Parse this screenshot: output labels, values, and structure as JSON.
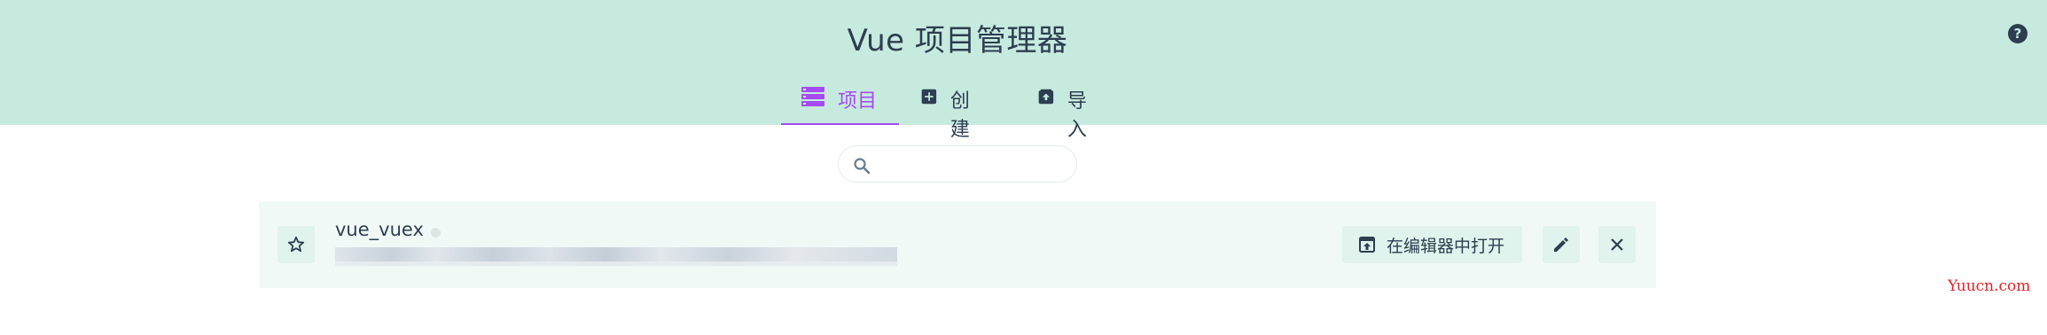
{
  "header": {
    "title": "Vue 项目管理器",
    "help_icon": "?",
    "background_color": "#c7eadf"
  },
  "tabs": [
    {
      "label": "项目",
      "icon": "list-icon",
      "active": true
    },
    {
      "label": "创建",
      "icon": "plus-square-icon",
      "active": false
    },
    {
      "label": "导入",
      "icon": "import-archive-icon",
      "active": false
    }
  ],
  "accent_color": "#a44cf1",
  "search": {
    "value": "",
    "placeholder": ""
  },
  "projects": [
    {
      "name": "vue_vuex",
      "path": "",
      "favorite": false,
      "open_label": "在编辑器中打开"
    }
  ],
  "watermark": "Yuucn.com"
}
